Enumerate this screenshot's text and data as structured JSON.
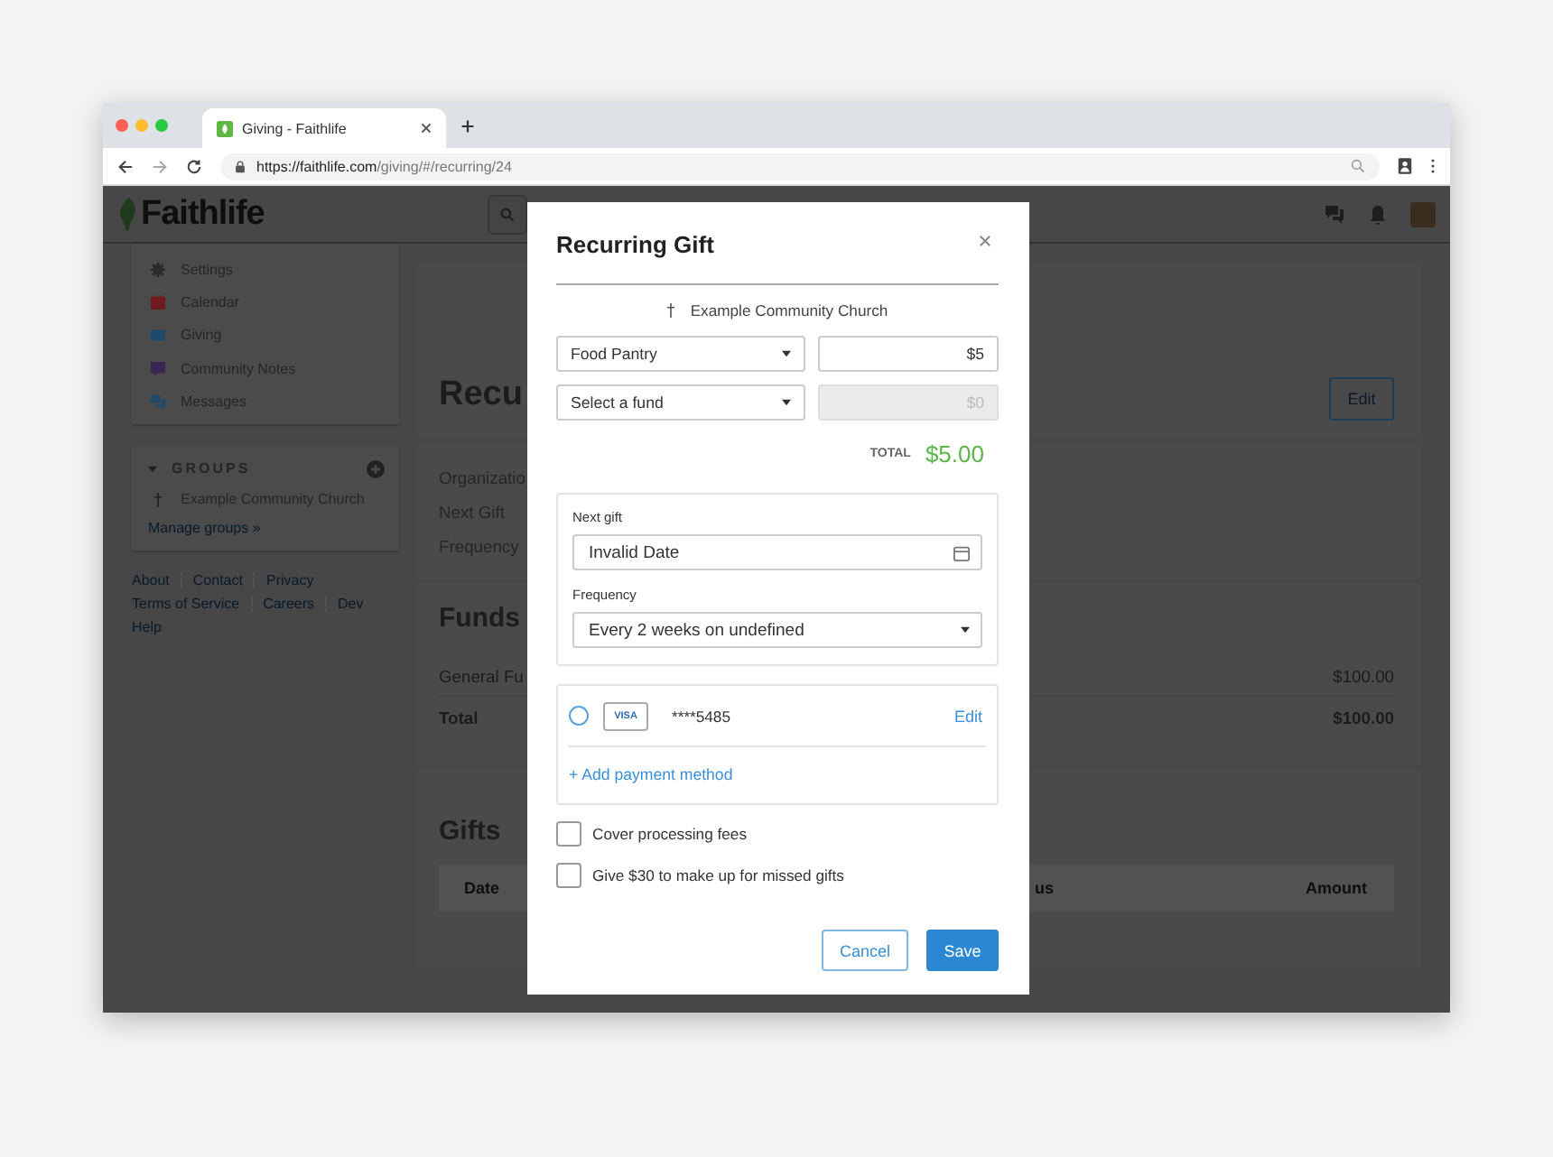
{
  "browser": {
    "tab_title": "Giving - Faithlife",
    "url_host": "https://faithlife.com",
    "url_path": "/giving/#/recurring/24"
  },
  "header": {
    "logo": "Faithlife"
  },
  "sidebar": {
    "items": [
      {
        "label": "Settings",
        "kind": "gear",
        "color": "#2b2b2b"
      },
      {
        "label": "Calendar",
        "kind": "calendar",
        "color": "#6e1a1f"
      },
      {
        "label": "Giving",
        "kind": "card",
        "color": "#1e4a6c"
      },
      {
        "label": "Community Notes",
        "kind": "note",
        "color": "#3b2552"
      },
      {
        "label": "Messages",
        "kind": "chat",
        "color": "#1e4a6c"
      }
    ],
    "groups": {
      "title": "GROUPS",
      "items": [
        {
          "label": "Example Community Church"
        }
      ],
      "manage": "Manage groups »"
    },
    "footer_links": [
      [
        "About",
        "Contact",
        "Privacy"
      ],
      [
        "Terms of Service",
        "Careers",
        "Dev"
      ],
      [
        "Help"
      ]
    ]
  },
  "main": {
    "title": "Recu",
    "edit_button": "Edit",
    "details": [
      "Organizatio",
      "Next Gift",
      "Frequency"
    ],
    "funds_title": "Funds",
    "funds": [
      {
        "name": "General Fu",
        "amount": "$100.00",
        "kind": "fund"
      },
      {
        "name": "Total",
        "amount": "$100.00",
        "kind": "total"
      }
    ],
    "gifts_title": "Gifts",
    "gift_columns": [
      "Date",
      "us",
      "Amount"
    ]
  },
  "modal": {
    "title": "Recurring Gift",
    "organization": "Example Community Church",
    "fund_lines": [
      {
        "fund": "Food Pantry",
        "amount": "$5",
        "disabled": false
      },
      {
        "fund": "Select a fund",
        "amount": "$0",
        "disabled": true
      }
    ],
    "total_label": "TOTAL",
    "total": "$5.00",
    "next_gift_label": "Next gift",
    "next_gift": "Invalid Date",
    "frequency_label": "Frequency",
    "frequency": "Every 2 weeks on undefined",
    "payment_methods": [
      {
        "brand": "VISA",
        "number": "****5485",
        "action": "Edit",
        "selected": false
      }
    ],
    "add_payment": "+ Add payment method",
    "options": [
      {
        "label": "Cover processing fees",
        "checked": false
      },
      {
        "label": "Give $30 to make up for missed gifts",
        "checked": false
      }
    ],
    "cancel": "Cancel",
    "save": "Save"
  }
}
